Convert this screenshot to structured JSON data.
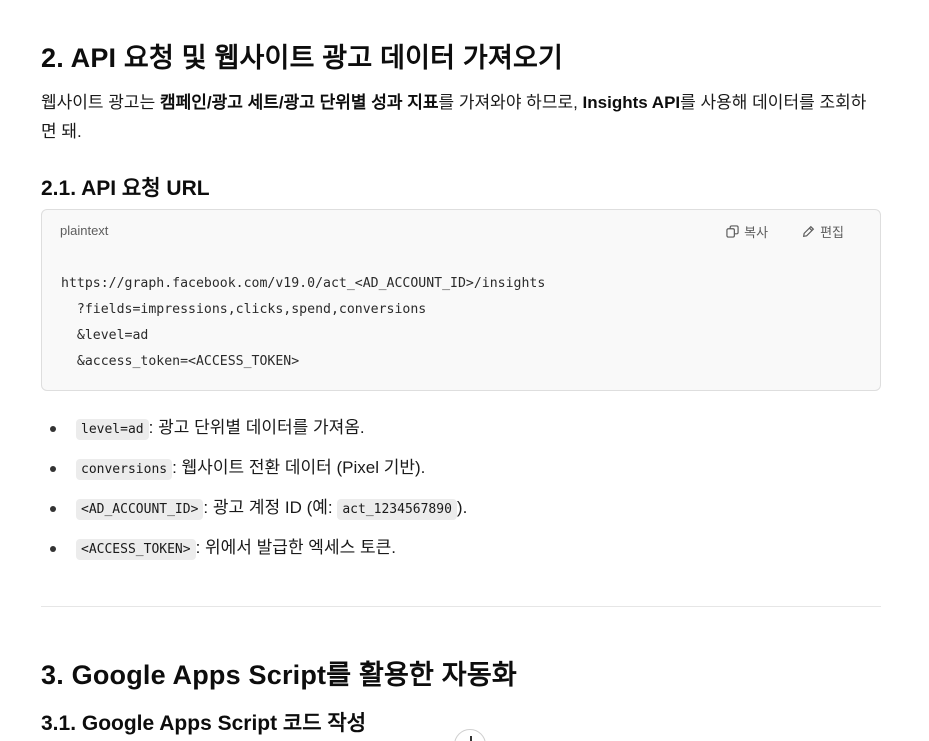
{
  "section2": {
    "title": "2. API 요청 및 웹사이트 광고 데이터 가져오기",
    "lead_parts": {
      "p1": "웹사이트 광고는 ",
      "b1": "캠페인/광고 세트/광고 단위별 성과 지표",
      "p2": "를 가져와야 하므로, ",
      "b2": "Insights API",
      "p3": "를 사용해 데이터를 조회하면 돼."
    },
    "subsection_title": "2.1. API 요청 URL",
    "code_block": {
      "language": "plaintext",
      "copy_label": "복사",
      "edit_label": "편집",
      "lines": [
        "https://graph.facebook.com/v19.0/act_<AD_ACCOUNT_ID>/insights",
        "  ?fields=impressions,clicks,spend,conversions",
        "  &level=ad",
        "  &access_token=<ACCESS_TOKEN>"
      ]
    },
    "bullets": [
      {
        "code": "level=ad",
        "text": ": 광고 단위별 데이터를 가져옴."
      },
      {
        "code": "conversions",
        "text": ": 웹사이트 전환 데이터 (Pixel 기반)."
      },
      {
        "code": "<AD_ACCOUNT_ID>",
        "text": ": 광고 계정 ID (예: ",
        "code2": "act_1234567890",
        "text2": ")."
      },
      {
        "code": "<ACCESS_TOKEN>",
        "text": ": 위에서 발급한 엑세스 토큰."
      }
    ]
  },
  "section3": {
    "title": "3. Google Apps Script를 활용한 자동화",
    "subsection_title": "3.1. Google Apps Script 코드 작성"
  },
  "icons": {
    "copy": "copy-icon",
    "edit": "pencil-icon",
    "scroll": "arrow-down-icon"
  }
}
